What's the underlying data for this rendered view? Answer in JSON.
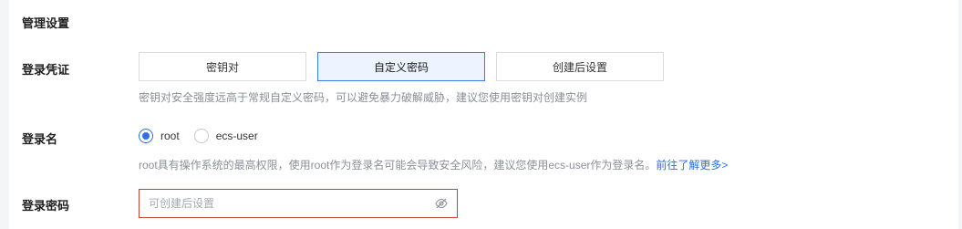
{
  "section": {
    "title": "管理设置"
  },
  "credential": {
    "label": "登录凭证",
    "options": [
      "密钥对",
      "自定义密码",
      "创建后设置"
    ],
    "selected": "自定义密码",
    "hint": "密钥对安全强度远高于常规自定义密码，可以避免暴力破解威胁，建议您使用密钥对创建实例"
  },
  "login_name": {
    "label": "登录名",
    "options": [
      "root",
      "ecs-user"
    ],
    "selected": "root",
    "hint": "root具有操作系统的最高权限，使用root作为登录名可能会导致安全风险，建议您使用ecs-user作为登录名。",
    "link": "前往了解更多>"
  },
  "password": {
    "label": "登录密码",
    "placeholder": "可创建后设置",
    "value": "",
    "icon": "eye-slash-icon"
  },
  "colors": {
    "accent": "#2f6ee0",
    "selected_bg": "#eef4ff",
    "error_border": "#c2453a"
  }
}
